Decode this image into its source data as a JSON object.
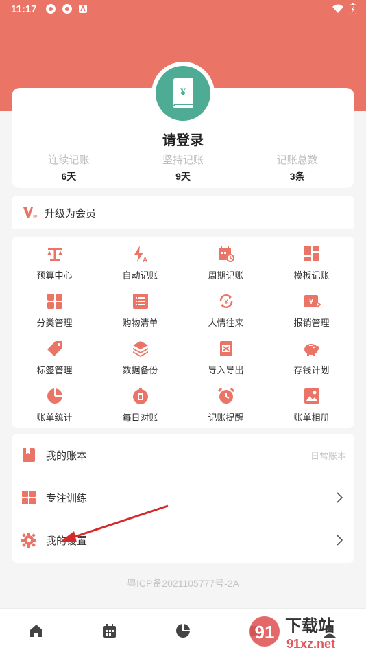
{
  "status_bar": {
    "time": "11:17"
  },
  "profile": {
    "login_title": "请登录",
    "stats": [
      {
        "label": "连续记账",
        "value": "6天"
      },
      {
        "label": "坚持记账",
        "value": "9天"
      },
      {
        "label": "记账总数",
        "value": "3条"
      }
    ]
  },
  "vip": {
    "label": "升级为会员"
  },
  "grid": [
    {
      "label": "预算中心",
      "icon": "scale-icon"
    },
    {
      "label": "自动记账",
      "icon": "flash-icon"
    },
    {
      "label": "周期记账",
      "icon": "calendar-clock-icon"
    },
    {
      "label": "模板记账",
      "icon": "template-icon"
    },
    {
      "label": "分类管理",
      "icon": "category-icon"
    },
    {
      "label": "购物清单",
      "icon": "list-icon"
    },
    {
      "label": "人情往来",
      "icon": "exchange-icon"
    },
    {
      "label": "报销管理",
      "icon": "reimburse-icon"
    },
    {
      "label": "标签管理",
      "icon": "tag-icon"
    },
    {
      "label": "数据备份",
      "icon": "layers-icon"
    },
    {
      "label": "导入导出",
      "icon": "excel-icon"
    },
    {
      "label": "存钱计划",
      "icon": "piggy-bank-icon"
    },
    {
      "label": "账单统计",
      "icon": "pie-chart-icon"
    },
    {
      "label": "每日对账",
      "icon": "daily-check-icon"
    },
    {
      "label": "记账提醒",
      "icon": "alarm-icon"
    },
    {
      "label": "账单相册",
      "icon": "image-icon"
    }
  ],
  "list": {
    "book": {
      "label": "我的账本",
      "value": "日常账本"
    },
    "focus": {
      "label": "专注训练"
    },
    "settings": {
      "label": "我的设置"
    }
  },
  "icp": "粤ICP备2021105777号-2A",
  "watermark": {
    "brand": "下载站",
    "domain": "91xz.net"
  },
  "colors": {
    "accent": "#ea7567",
    "avatar": "#4fac94"
  }
}
